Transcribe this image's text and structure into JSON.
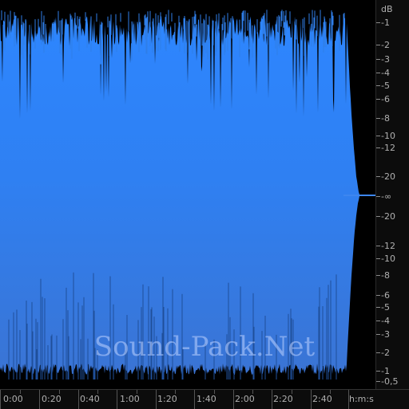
{
  "watermark": "Sound-Pack.Net",
  "colors": {
    "waveform_top": "#2f86ff",
    "waveform_bottom": "#3a78d8",
    "waveform_line": "#6aa8ff",
    "background": "#000000",
    "ruler_text": "#b0b0b0"
  },
  "db_ruler": {
    "unit": "dB",
    "top_labels": [
      "-1",
      "-2",
      "-3",
      "-4",
      "-5",
      "-6",
      "-8",
      "-10",
      "-12",
      "-20"
    ],
    "center_label": "-∞",
    "bottom_labels": [
      "-20",
      "-12",
      "-10",
      "-8",
      "-6",
      "-5",
      "-4",
      "-3",
      "-2",
      "-1",
      "-0,5"
    ]
  },
  "time_ruler": {
    "unit": "h:m:s",
    "labels": [
      "0:00",
      "0:20",
      "0:40",
      "1:00",
      "1:20",
      "1:40",
      "2:00",
      "2:20",
      "2:40"
    ]
  }
}
